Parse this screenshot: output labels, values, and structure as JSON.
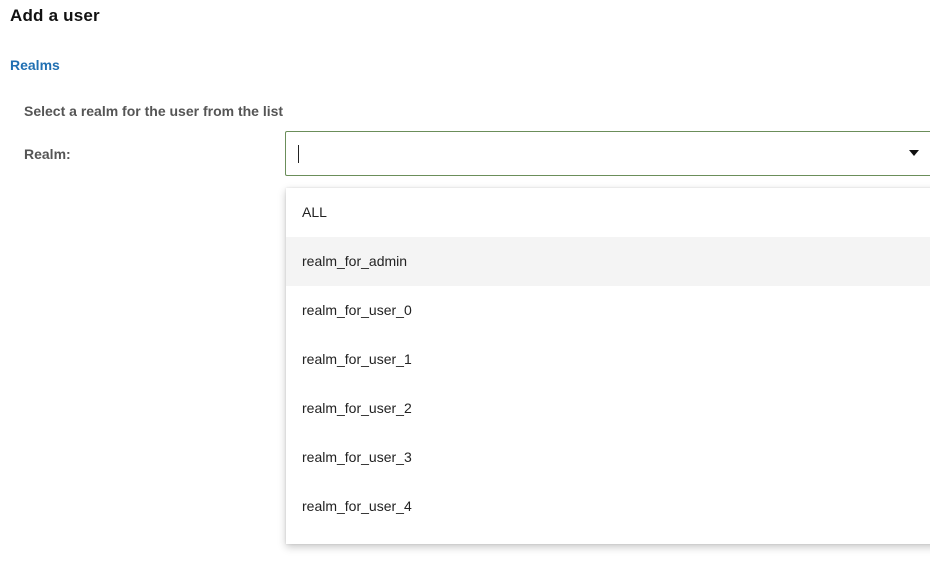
{
  "header": {
    "title": "Add a user"
  },
  "section": {
    "title": "Realms",
    "instruction": "Select a realm for the user from the list"
  },
  "realm_field": {
    "label": "Realm:",
    "value": "",
    "placeholder": "",
    "options": [
      {
        "label": "ALL",
        "highlighted": false
      },
      {
        "label": "realm_for_admin",
        "highlighted": true
      },
      {
        "label": "realm_for_user_0",
        "highlighted": false
      },
      {
        "label": "realm_for_user_1",
        "highlighted": false
      },
      {
        "label": "realm_for_user_2",
        "highlighted": false
      },
      {
        "label": "realm_for_user_3",
        "highlighted": false
      },
      {
        "label": "realm_for_user_4",
        "highlighted": false
      }
    ]
  },
  "icons": {
    "dropdown": "caret-down-icon"
  },
  "colors": {
    "section_title": "#1f6fb2",
    "input_border": "#6b8e5a",
    "option_highlight": "#f4f4f4"
  }
}
